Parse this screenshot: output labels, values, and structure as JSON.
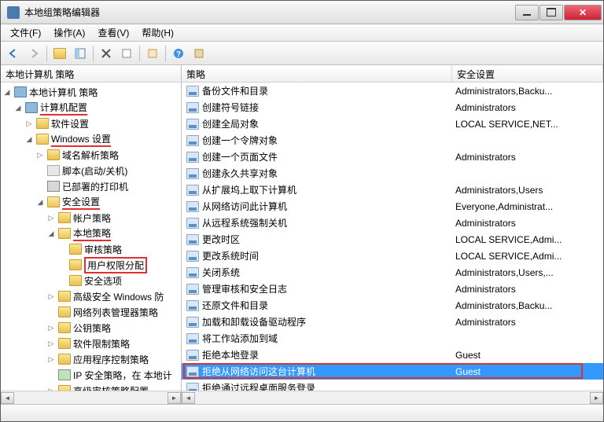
{
  "window": {
    "title": "本地组策略编辑器"
  },
  "menu": {
    "file": "文件(F)",
    "action": "操作(A)",
    "view": "查看(V)",
    "help": "帮助(H)"
  },
  "tree": {
    "header": "本地计算机 策略",
    "nodes": {
      "root": "本地计算机 策略",
      "comp_config": "计算机配置",
      "soft_settings": "软件设置",
      "win_settings": "Windows 设置",
      "dns_policy": "域名解析策略",
      "scripts": "脚本(启动/关机)",
      "printers": "已部署的打印机",
      "sec_settings": "安全设置",
      "account_policy": "帐户策略",
      "local_policy": "本地策略",
      "audit_policy": "审核策略",
      "user_rights": "用户权限分配",
      "sec_options": "安全选项",
      "adv_firewall": "高级安全 Windows 防",
      "net_list_mgr": "网络列表管理器策略",
      "pubkey_policy": "公钥策略",
      "soft_restrict": "软件限制策略",
      "app_control": "应用程序控制策略",
      "ip_sec": "IP 安全策略，在 本地计",
      "adv_audit": "高级审核策略配置"
    }
  },
  "list": {
    "col_policy": "策略",
    "col_security": "安全设置",
    "rows": [
      {
        "policy": "备份文件和目录",
        "setting": "Administrators,Backu..."
      },
      {
        "policy": "创建符号链接",
        "setting": "Administrators"
      },
      {
        "policy": "创建全局对象",
        "setting": "LOCAL SERVICE,NET..."
      },
      {
        "policy": "创建一个令牌对象",
        "setting": ""
      },
      {
        "policy": "创建一个页面文件",
        "setting": "Administrators"
      },
      {
        "policy": "创建永久共享对象",
        "setting": ""
      },
      {
        "policy": "从扩展坞上取下计算机",
        "setting": "Administrators,Users"
      },
      {
        "policy": "从网络访问此计算机",
        "setting": "Everyone,Administrat..."
      },
      {
        "policy": "从远程系统强制关机",
        "setting": "Administrators"
      },
      {
        "policy": "更改时区",
        "setting": "LOCAL SERVICE,Admi..."
      },
      {
        "policy": "更改系统时间",
        "setting": "LOCAL SERVICE,Admi..."
      },
      {
        "policy": "关闭系统",
        "setting": "Administrators,Users,..."
      },
      {
        "policy": "管理审核和安全日志",
        "setting": "Administrators"
      },
      {
        "policy": "还原文件和目录",
        "setting": "Administrators,Backu..."
      },
      {
        "policy": "加载和卸载设备驱动程序",
        "setting": "Administrators"
      },
      {
        "policy": "将工作站添加到域",
        "setting": ""
      },
      {
        "policy": "拒绝本地登录",
        "setting": "Guest"
      },
      {
        "policy": "拒绝从网络访问这台计算机",
        "setting": "Guest",
        "selected": true
      },
      {
        "policy": "拒绝通过远程桌面服务登录",
        "setting": ""
      }
    ]
  }
}
